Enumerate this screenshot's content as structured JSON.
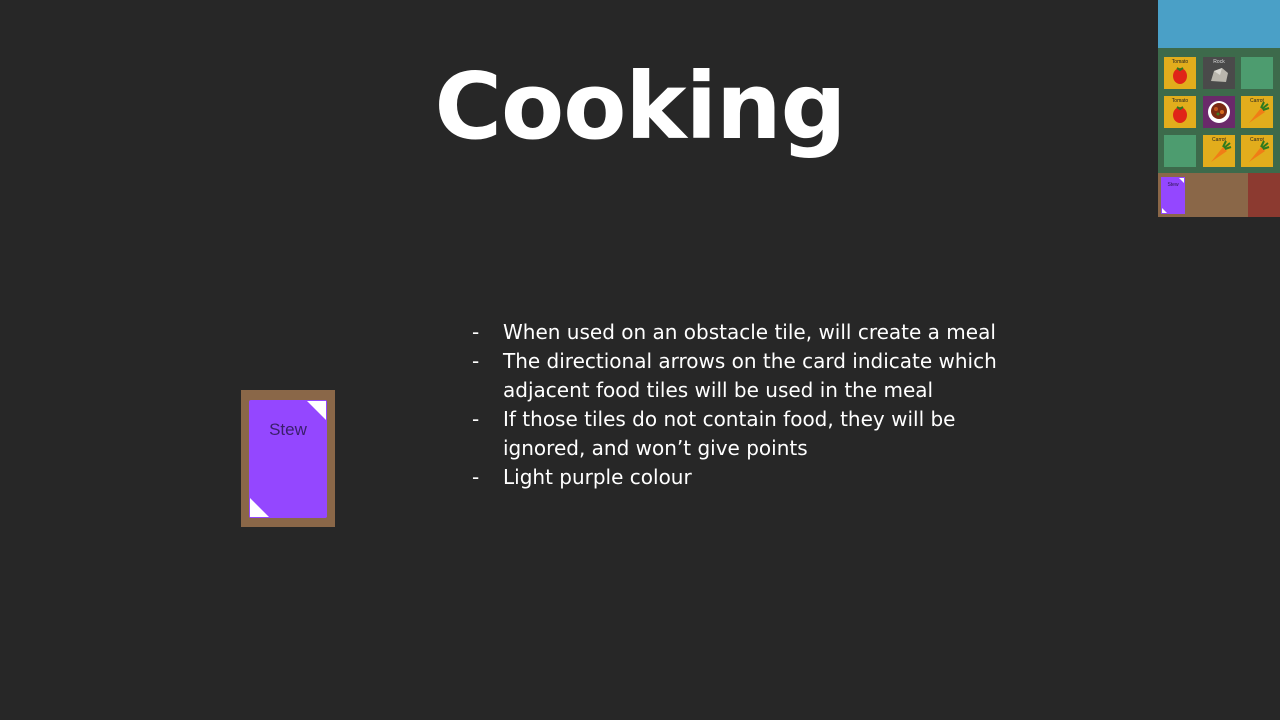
{
  "slide": {
    "title": "Cooking",
    "bullets": [
      {
        "marker": "-",
        "text": "When used on an obstacle tile, will create a meal"
      },
      {
        "marker": "-",
        "text": "The directional arrows on the card indicate which adjacent food tiles will be used in the meal"
      },
      {
        "marker": "-",
        "text": "If those tiles do not contain food, they will be ignored, and won’t give points"
      },
      {
        "marker": "-",
        "text": "Light purple colour"
      }
    ]
  },
  "card": {
    "label": "Stew",
    "color": "#9447ff"
  },
  "minimap": {
    "tiles": [
      {
        "label": "Tomato",
        "kind": "tomato-icon"
      },
      {
        "label": "Rock",
        "kind": "rock-icon"
      },
      {
        "label": "",
        "kind": "grass"
      },
      {
        "label": "Tomato",
        "kind": "tomato-icon"
      },
      {
        "label": "",
        "kind": "stew-bowl-icon"
      },
      {
        "label": "Carrot",
        "kind": "carrot-icon"
      },
      {
        "label": "",
        "kind": "grass"
      },
      {
        "label": "Carrot",
        "kind": "carrot-icon"
      },
      {
        "label": "Carrot",
        "kind": "carrot-icon"
      }
    ],
    "hand_card_label": "Stew"
  },
  "colors": {
    "background": "#272727",
    "card_purple": "#9447ff",
    "card_frame": "#8a6748",
    "sky": "#4aa0c7",
    "grass": "#3d6a4b",
    "food_tile": "#e2ad1c"
  }
}
